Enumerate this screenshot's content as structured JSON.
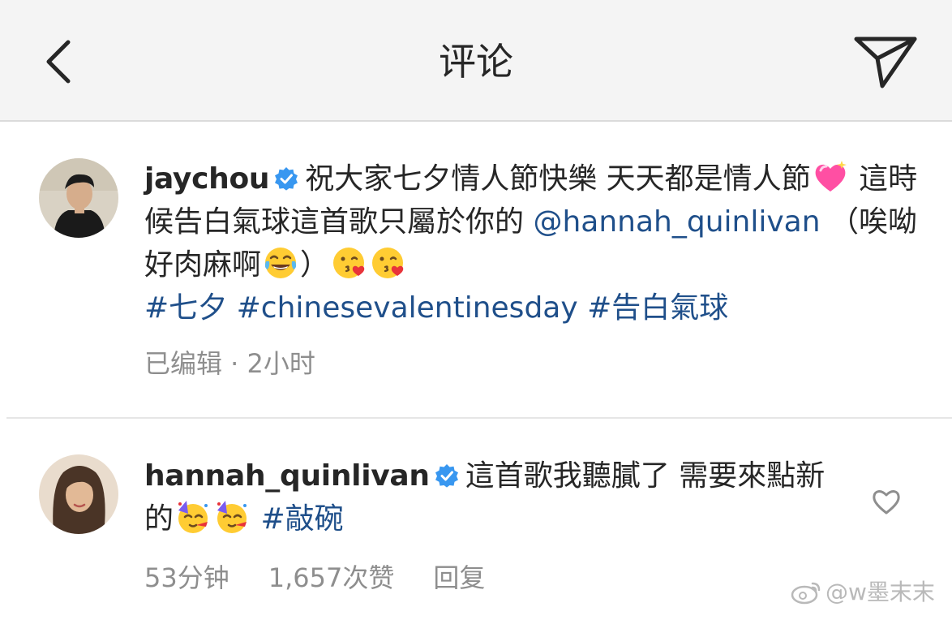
{
  "header": {
    "title": "评论",
    "back_icon": "chevron-left-icon",
    "share_icon": "paper-plane-icon"
  },
  "comments": [
    {
      "username": "jaychou",
      "verified": true,
      "text_1": "祝大家七夕情人節快樂 天天都是情人節",
      "text_2": " 這時候告白氣球這首歌只屬於你的",
      "mention": "@hannah_quinlivan",
      "text_3": " （唉呦 好肉麻啊",
      "text_4": "）",
      "hashtags": [
        "#七夕",
        "#chinesevalentinesday",
        "#告白氣球"
      ],
      "emojis": [
        "sparkling-heart-emoji",
        "tears-of-joy-emoji",
        "kissing-heart-emoji",
        "kissing-heart-emoji"
      ],
      "meta": "已编辑 · 2小时"
    },
    {
      "username": "hannah_quinlivan",
      "verified": true,
      "text_1": "這首歌我聽膩了 需要來點新的",
      "hashtag": "#敲碗",
      "emojis": [
        "partying-face-emoji",
        "partying-face-emoji"
      ],
      "time": "53分钟",
      "likes": "1,657次赞",
      "reply": "回复"
    }
  ],
  "watermark": "@w墨末末",
  "colors": {
    "link": "#1f4f8a",
    "verified": "#3897f0",
    "meta": "#8e8e8e",
    "header_bg": "#f4f4f4"
  }
}
